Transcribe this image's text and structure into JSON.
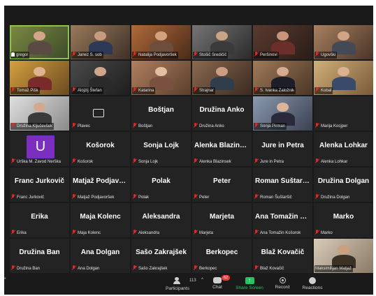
{
  "participants": [
    {
      "label": "gregor",
      "video": true,
      "active": true,
      "pinned": true,
      "c1": "#7d8a43",
      "c2": "#3b4a2a",
      "skin": "#d4a48a",
      "shirt": "#5a4a44"
    },
    {
      "label": "Janez S. sob",
      "video": true,
      "c1": "#9a7a5a",
      "c2": "#3e3028",
      "skin": "#c79b7e",
      "shirt": "#2e3a55"
    },
    {
      "label": "Natalija Podjavoršek",
      "video": true,
      "c1": "#b06a3a",
      "c2": "#4a2a1a",
      "skin": "#d2a27f",
      "shirt": "#6d4d3b"
    },
    {
      "label": "Stošič Sredičič",
      "video": true,
      "c1": "#757575",
      "c2": "#2a2a2a",
      "skin": "#caa284",
      "shirt": "#3b3b3b"
    },
    {
      "label": "Peršinovi",
      "video": true,
      "c1": "#5a3a30",
      "c2": "#2a1d18",
      "skin": "#c89478",
      "shirt": "#6a2f2a"
    },
    {
      "label": "Ugovški",
      "video": true,
      "c1": "#a88060",
      "c2": "#4a3428",
      "skin": "#d2a486",
      "shirt": "#444a55"
    },
    {
      "label": "Tomaž Pišk",
      "video": true,
      "c1": "#d4a040",
      "c2": "#6a4a20",
      "skin": "#e0b490",
      "shirt": "#7a2a2a"
    },
    {
      "label": "Alojzij Štefan",
      "video": true,
      "c1": "#4a4a4a",
      "c2": "#1e1e1e",
      "skin": "#cfa58c",
      "shirt": "#2a2a2a"
    },
    {
      "label": "Katarina",
      "video": true,
      "c1": "#b08060",
      "c2": "#5a3e2c",
      "skin": "#e4bea2",
      "shirt": "#7a5040"
    },
    {
      "label": "Strajnar",
      "video": true,
      "c1": "#8a6a50",
      "c2": "#3a2a20",
      "skin": "#cc9f84",
      "shirt": "#2f3e4a"
    },
    {
      "label": "S. Ivanka Založnik",
      "video": true,
      "c1": "#a07a58",
      "c2": "#4a3626",
      "skin": "#d6ac90",
      "shirt": "#1e1e28"
    },
    {
      "label": "Kobal",
      "video": true,
      "c1": "#d0b078",
      "c2": "#7a5a3a",
      "skin": "#dcb292",
      "shirt": "#3a4a6a"
    },
    {
      "label": "Družina Ključevšek",
      "video": true,
      "c1": "#e0e0e0",
      "c2": "#8a8a8a",
      "skin": "#d4a890",
      "shirt": "#3a3a3a"
    },
    {
      "label": "Plavec",
      "video": false,
      "camoff": true
    },
    {
      "label": "Boštjan",
      "display": "Boštjan",
      "video": false
    },
    {
      "label": "Družina Anko",
      "display": "Družina Anko",
      "video": false
    },
    {
      "label": "Sonja Pirman",
      "video": true,
      "c1": "#8a9ab0",
      "c2": "#3a4050",
      "skin": "#dcb49a",
      "shirt": "#2a2a3a"
    },
    {
      "label": "Marija Kocjper",
      "video": false
    },
    {
      "label": "Urška M. Zavod Nerška",
      "video": false,
      "avatar": "U"
    },
    {
      "label": "Košorok",
      "display": "Košorok",
      "video": false
    },
    {
      "label": "Sonja Lojk",
      "display": "Sonja Lojk",
      "video": false
    },
    {
      "label": "Alenka Blazinsek",
      "display": "Alenka Blazinsek",
      "video": false
    },
    {
      "label": "Jure in Petra",
      "display": "Jure in Petra",
      "video": false
    },
    {
      "label": "Alenka Lohkar",
      "display": "Alenka Lohkar",
      "video": false
    },
    {
      "label": "Franc Jurkovič",
      "display": "Franc Jurkovič",
      "video": false
    },
    {
      "label": "Matjaž Podjavoršek",
      "display": "Matjaž  Podjavo...",
      "video": false
    },
    {
      "label": "Polak",
      "display": "Polak",
      "video": false
    },
    {
      "label": "Peter",
      "display": "Peter",
      "video": false
    },
    {
      "label": "Roman Šuštaršič",
      "display": "Roman Šuštaršič",
      "video": false
    },
    {
      "label": "Družina Dolgan",
      "display": "Družina Dolgan",
      "video": false
    },
    {
      "label": "Erika",
      "display": "Erika",
      "video": false
    },
    {
      "label": "Maja Kolenc",
      "display": "Maja Kolenc",
      "video": false
    },
    {
      "label": "Aleksandra",
      "display": "Aleksandra",
      "video": false
    },
    {
      "label": "Marjeta",
      "display": "Marjeta",
      "video": false
    },
    {
      "label": "Ana Tomažin Košorok",
      "display": "Ana Tomažin Ko...",
      "video": false
    },
    {
      "label": "Marko",
      "display": "Marko",
      "video": false
    },
    {
      "label": "Družina Ban",
      "display": "Družina Ban",
      "video": false
    },
    {
      "label": "Ana Dolgan",
      "display": "Ana Dolgan",
      "video": false
    },
    {
      "label": "Sašo Zakrajšek",
      "display": "Sašo Zakrajšek",
      "video": false
    },
    {
      "label": "Berkopec",
      "display": "Berkopec",
      "video": false
    },
    {
      "label": "Blaž Kovačič",
      "display": "Blaž Kovačič",
      "video": false
    },
    {
      "label": "Maksimilijan Matjaž",
      "video": true,
      "nomic": true,
      "c1": "#d8cbb8",
      "c2": "#8a7a68",
      "skin": "#caa07e",
      "shirt": "#3b3226"
    }
  ],
  "toolbar": {
    "participants_label": "Participants",
    "participants_count": "113",
    "chat_label": "Chat",
    "chat_badge": "62",
    "share_label": "Share Screen",
    "record_label": "Record",
    "reactions_label": "Reactions"
  }
}
